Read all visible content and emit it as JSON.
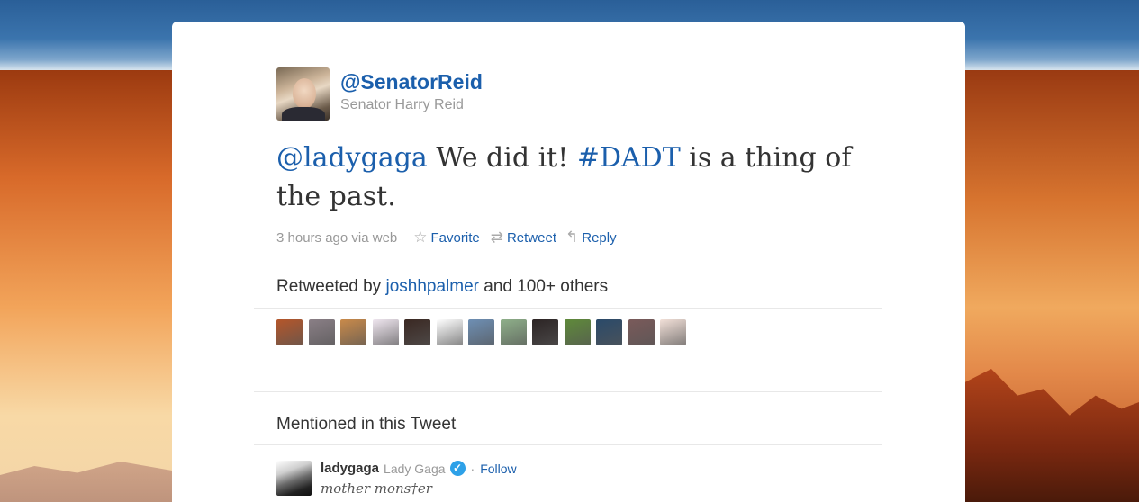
{
  "tweet": {
    "author": {
      "handle": "@SenatorReid",
      "name": "Senator Harry Reid"
    },
    "text_parts": {
      "mention": "@ladygaga",
      "middle": " We did it! ",
      "hashtag": "#DADT",
      "end": " is a thing of the past."
    },
    "meta": {
      "time": "3 hours ago via web",
      "favorite_label": "Favorite",
      "retweet_label": "Retweet",
      "reply_label": "Reply"
    }
  },
  "retweets": {
    "prefix": "Retweeted by ",
    "user": "joshhpalmer",
    "suffix": " and 100+ others",
    "avatar_colors": [
      "#b5562a",
      "#8a7f86",
      "#c98a4a",
      "#efe6ef",
      "#3a2822",
      "#ffffff",
      "#6e8fb4",
      "#8fb08a",
      "#2c2424",
      "#5f8a3a",
      "#2a4a6a",
      "#7a5a5a",
      "#f2e0d8"
    ]
  },
  "mentioned": {
    "heading": "Mentioned in this Tweet",
    "user": {
      "handle": "ladygaga",
      "name": "Lady Gaga",
      "verified_icon": "verified-check-icon",
      "separator": "·",
      "follow_label": "Follow",
      "bio": "mother mons†er"
    }
  },
  "icons": {
    "favorite": "star-icon",
    "retweet": "retweet-icon",
    "reply": "reply-arrow-icon"
  },
  "colors": {
    "link": "#1b5fac",
    "muted": "#999999",
    "text": "#333333",
    "verified": "#2ea1e8"
  }
}
